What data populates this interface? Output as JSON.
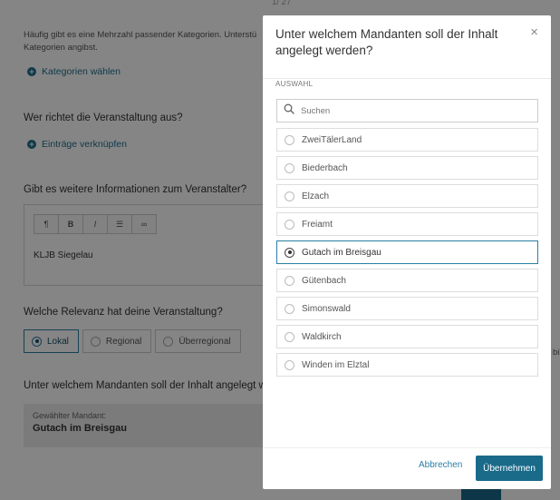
{
  "background": {
    "page_indicator": "1/ 27",
    "categories_hint_line1": "Häufig gibt es eine Mehrzahl passender Kategorien. Unterstü",
    "categories_hint_line2": "Kategorien angibst.",
    "choose_categories": "Kategorien wählen",
    "organizer_question": "Wer richtet die Veranstaltung aus?",
    "link_entries": "Einträge verknüpfen",
    "more_info_question": "Gibt es weitere Informationen zum Veranstalter?",
    "editor_toolbar": [
      "¶",
      "B",
      "I",
      "☰",
      "∞"
    ],
    "editor_text": "KLJB Siegelau",
    "relevance_question": "Welche Relevanz hat deine Veranstaltung?",
    "relevance_options": [
      {
        "label": "Lokal",
        "checked": true
      },
      {
        "label": "Regional",
        "checked": false
      },
      {
        "label": "Überregional",
        "checked": false
      }
    ],
    "client_question": "Unter welchem Mandanten soll der Inhalt angelegt we",
    "selected_client_label": "Gewählter Mandant:",
    "selected_client_value": "Gutach im Breisgau",
    "right_edge_text": "bi"
  },
  "modal": {
    "title": "Unter welchem Mandanten soll der Inhalt angelegt werden?",
    "close_label": "×",
    "section_label": "AUSWAHL",
    "search_placeholder": "Suchen",
    "options": [
      {
        "label": "ZweiTälerLand",
        "selected": false
      },
      {
        "label": "Biederbach",
        "selected": false
      },
      {
        "label": "Elzach",
        "selected": false
      },
      {
        "label": "Freiamt",
        "selected": false
      },
      {
        "label": "Gutach im Breisgau",
        "selected": true
      },
      {
        "label": "Gütenbach",
        "selected": false
      },
      {
        "label": "Simonswald",
        "selected": false
      },
      {
        "label": "Waldkirch",
        "selected": false
      },
      {
        "label": "Winden im Elztal",
        "selected": false
      }
    ],
    "cancel_label": "Abbrechen",
    "apply_label": "Übernehmen"
  },
  "colors": {
    "accent": "#1a6a8a",
    "link": "#1d6f8f",
    "overlay": "rgba(0,0,0,0.48)"
  },
  "icons": {
    "search": "search-icon",
    "close": "close-icon",
    "add": "plus-circle-icon"
  }
}
